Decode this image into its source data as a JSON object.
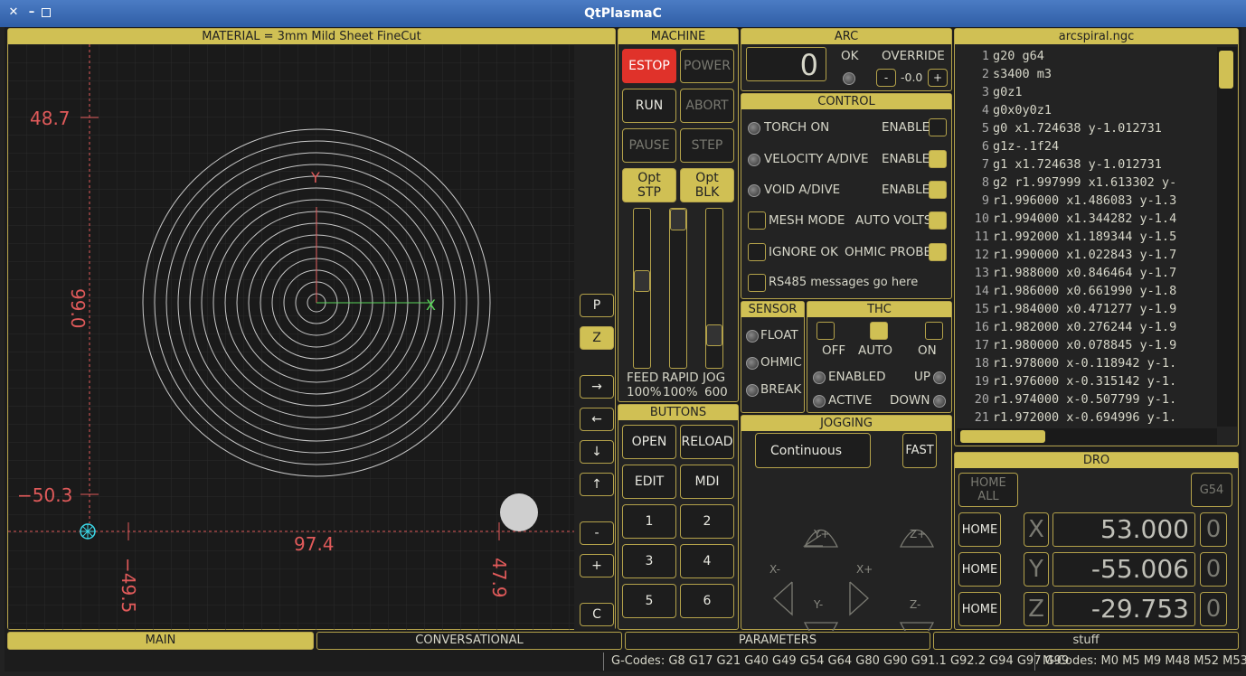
{
  "window": {
    "title": "QtPlasmaC"
  },
  "preview": {
    "header": "MATERIAL = 3mm Mild Sheet FineCut",
    "y_max": "48.7",
    "y_min": "−50.3",
    "y_extent": "99.0",
    "x_min": "−49.5",
    "x_max": "47.9",
    "x_extent": "97.4",
    "axis_y": "Y",
    "axis_x": "X",
    "side_buttons": [
      "P",
      "Z",
      "→",
      "←",
      "↓",
      "↑",
      "-",
      "+",
      "C"
    ]
  },
  "machine": {
    "header": "MACHINE",
    "estop": "ESTOP",
    "power": "POWER",
    "run": "RUN",
    "abort": "ABORT",
    "pause": "PAUSE",
    "step": "STEP",
    "opt_stp": "Opt\nSTP",
    "opt_blk": "Opt\nBLK",
    "feed": "FEED",
    "feed_val": "100%",
    "rapid": "RAPID",
    "rapid_val": "100%",
    "jog": "JOG",
    "jog_val": "600",
    "feed_level": 0.55,
    "rapid_level": 1.0,
    "jog_level": 0.15
  },
  "buttons": {
    "header": "BUTTONS",
    "open": "OPEN",
    "reload": "RELOAD",
    "edit": "EDIT",
    "mdi": "MDI",
    "b1": "1",
    "b2": "2",
    "b3": "3",
    "b4": "4",
    "b5": "5",
    "b6": "6"
  },
  "arc": {
    "header": "ARC",
    "value": "0",
    "ok": "OK",
    "override": "OVERRIDE",
    "minus": "-",
    "override_val": "-0.0",
    "plus": "+"
  },
  "control": {
    "header": "CONTROL",
    "torch_on": "TORCH ON",
    "velocity": "VELOCITY A/DIVE",
    "void": "VOID A/DIVE",
    "enable": "ENABLE",
    "mesh": "MESH MODE",
    "auto_volts": "AUTO VOLTS",
    "ignore_ok": "IGNORE OK",
    "ohmic_probe": "OHMIC PROBE",
    "rs485": "RS485 messages go here"
  },
  "sensor": {
    "header": "SENSOR",
    "float": "FLOAT",
    "ohmic": "OHMIC",
    "break": "BREAK"
  },
  "thc": {
    "header": "THC",
    "off": "OFF",
    "auto": "AUTO",
    "on": "ON",
    "enabled": "ENABLED",
    "active": "ACTIVE",
    "up": "UP",
    "down": "DOWN"
  },
  "jogging": {
    "header": "JOGGING",
    "mode": "Continuous",
    "fast": "FAST",
    "yplus": "Y+",
    "zplus": "Z+",
    "xminus": "X-",
    "xplus": "X+",
    "yminus": "Y-",
    "zminus": "Z-"
  },
  "gcode": {
    "header": "arcspiral.ngc",
    "lines": [
      "g20 g64",
      "s3400 m3",
      "g0z1",
      "g0x0y0z1",
      "g0 x1.724638 y-1.012731",
      "g1z-.1f24",
      "g1 x1.724638 y-1.012731",
      "g2 r1.997999 x1.613302 y-",
      "r1.996000 x1.486083 y-1.3",
      "r1.994000 x1.344282 y-1.4",
      "r1.992000 x1.189344 y-1.5",
      "r1.990000 x1.022843 y-1.7",
      "r1.988000 x0.846464 y-1.7",
      "r1.986000 x0.661990 y-1.8",
      "r1.984000 x0.471277 y-1.9",
      "r1.982000 x0.276244 y-1.9",
      "r1.980000 x0.078845 y-1.9",
      "r1.978000 x-0.118942 y-1.",
      "r1.976000 x-0.315142 y-1.",
      "r1.974000 x-0.507799 y-1.",
      "r1.972000 x-0.694996 y-1."
    ]
  },
  "dro": {
    "header": "DRO",
    "home_all": "HOME ALL",
    "wcs": "G54",
    "home": "HOME",
    "x_label": "X",
    "x_val": "53.000",
    "y_label": "Y",
    "y_val": "-55.006",
    "z_label": "Z",
    "z_val": "-29.753",
    "idx": "0"
  },
  "tabs": {
    "main": "MAIN",
    "conversational": "CONVERSATIONAL",
    "parameters": "PARAMETERS",
    "stuff": "stuff"
  },
  "status": {
    "gcodes": "G-Codes: G8 G17 G21 G40 G49 G54 G64 G80 G90 G91.1 G92.2 G94 G97 G99",
    "mcodes": "M-Codes: M0 M5 M9 M48 M52 M53"
  }
}
